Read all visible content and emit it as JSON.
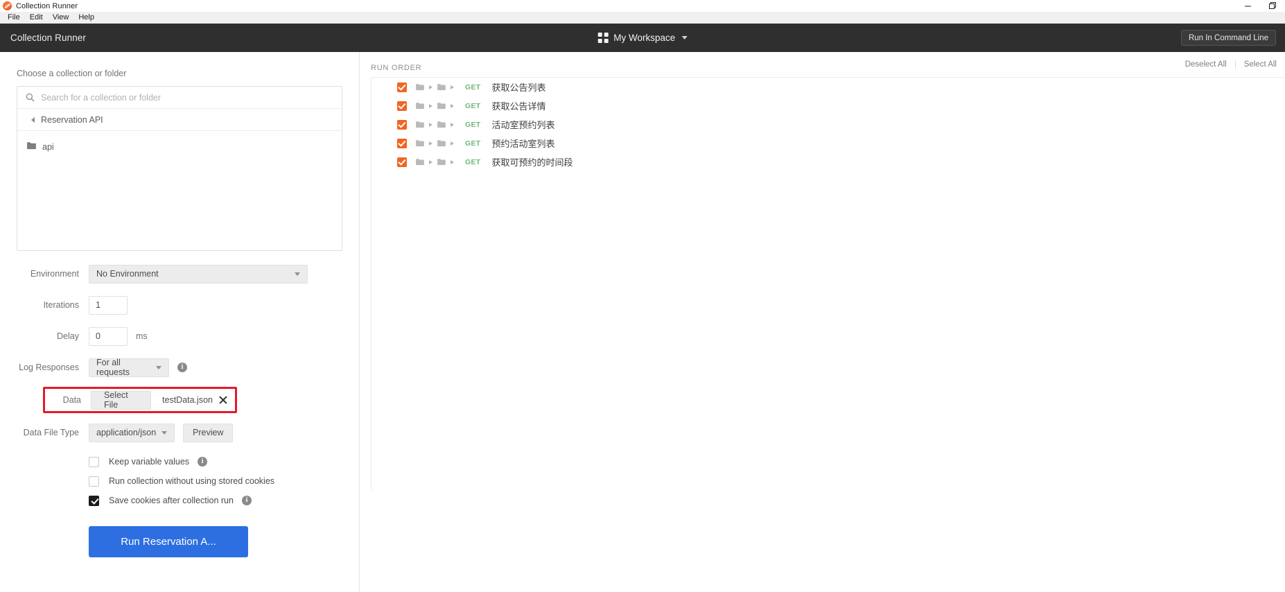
{
  "window": {
    "title": "Collection Runner",
    "app_icon": "postman-logo-icon",
    "controls": {
      "minimize": "minimize-icon",
      "maximize": "maximize-icon"
    }
  },
  "menubar": {
    "items": [
      "File",
      "Edit",
      "View",
      "Help"
    ]
  },
  "header": {
    "brand": "Collection Runner",
    "workspace": "My Workspace",
    "run_cli_label": "Run In Command Line"
  },
  "left": {
    "section_label": "Choose a collection or folder",
    "search": {
      "placeholder": "Search for a collection or folder",
      "value": ""
    },
    "breadcrumb": "Reservation API",
    "tree": [
      {
        "label": "api",
        "icon": "folder-icon"
      }
    ],
    "form": {
      "environment": {
        "label": "Environment",
        "value": "No Environment"
      },
      "iterations": {
        "label": "Iterations",
        "value": "1"
      },
      "delay": {
        "label": "Delay",
        "value": "0",
        "unit": "ms"
      },
      "log_responses": {
        "label": "Log Responses",
        "value": "For all requests"
      },
      "data": {
        "label": "Data",
        "select_file_label": "Select File",
        "file_name": "testData.json",
        "clear_icon": "close-icon",
        "highlight_color": "#e8182b"
      },
      "data_file_type": {
        "label": "Data File Type",
        "value": "application/json",
        "preview_label": "Preview"
      }
    },
    "checkboxes": [
      {
        "label": "Keep variable values",
        "checked": false,
        "info": true
      },
      {
        "label": "Run collection without using stored cookies",
        "checked": false,
        "info": false
      },
      {
        "label": "Save cookies after collection run",
        "checked": true,
        "info": true
      }
    ],
    "run_button": {
      "label": "Run Reservation A...",
      "color": "#2d6fe0"
    }
  },
  "right": {
    "title": "RUN ORDER",
    "deselect_all": "Deselect All",
    "select_all": "Select All",
    "method_color": "#6fba77",
    "checkbox_color": "#f26522",
    "items": [
      {
        "checked": true,
        "method": "GET",
        "name": "获取公告列表"
      },
      {
        "checked": true,
        "method": "GET",
        "name": "获取公告详情"
      },
      {
        "checked": true,
        "method": "GET",
        "name": "活动室预约列表"
      },
      {
        "checked": true,
        "method": "GET",
        "name": "预约活动室列表"
      },
      {
        "checked": true,
        "method": "GET",
        "name": "获取可预约的时间段"
      }
    ]
  }
}
